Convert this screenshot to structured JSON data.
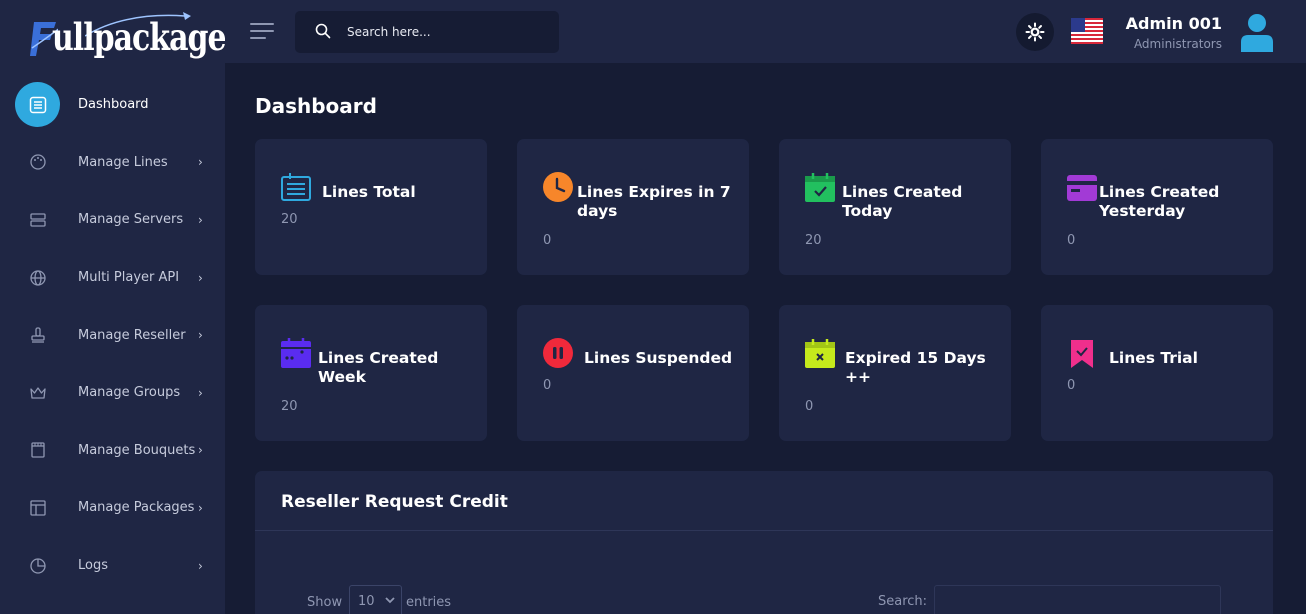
{
  "brand": {
    "logo_text": "ullpackage"
  },
  "sidebar": {
    "items": [
      {
        "label": "Dashboard",
        "icon": "dashboard-icon",
        "active": true
      },
      {
        "label": "Manage Lines",
        "icon": "palette-icon"
      },
      {
        "label": "Manage Servers",
        "icon": "server-icon"
      },
      {
        "label": "Multi Player API",
        "icon": "globe-icon"
      },
      {
        "label": "Manage Reseller",
        "icon": "stamp-icon"
      },
      {
        "label": "Manage Groups",
        "icon": "crown-icon"
      },
      {
        "label": "Manage Bouquets",
        "icon": "film-icon"
      },
      {
        "label": "Manage Packages",
        "icon": "layout-icon"
      },
      {
        "label": "Logs",
        "icon": "pie-chart-icon"
      }
    ],
    "chevron": "›"
  },
  "topbar": {
    "search_placeholder": "Search here...",
    "user_name": "Admin 001",
    "user_role": "Administrators"
  },
  "page": {
    "title": "Dashboard"
  },
  "cards": [
    {
      "title": "Lines Total",
      "value": "20",
      "icon": "list-icon",
      "color": "#2fa9df"
    },
    {
      "title": "Lines Expires in 7 days",
      "value": "0",
      "icon": "clock-icon",
      "color": "#f7862a"
    },
    {
      "title": "Lines Created Today",
      "value": "20",
      "icon": "calendar-check-icon",
      "color": "#22c05f"
    },
    {
      "title": "Lines Created Yesterday",
      "value": "0",
      "icon": "card-icon",
      "color": "#a23ad6"
    },
    {
      "title": "Lines Created Week",
      "value": "20",
      "icon": "calendar-week-icon",
      "color": "#5a2cf0"
    },
    {
      "title": "Lines Suspended",
      "value": "0",
      "icon": "pause-icon",
      "color": "#f0293b"
    },
    {
      "title": "Expired 15 Days ++",
      "value": "0",
      "icon": "calendar-x-icon",
      "color": "#c5ea1c"
    },
    {
      "title": "Lines Trial",
      "value": "0",
      "icon": "bookmark-check-icon",
      "color": "#f02f8c"
    }
  ],
  "reseller_panel": {
    "title": "Reseller Request Credit",
    "show_label": "Show",
    "entries_value": "10",
    "entries_label": "entries",
    "search_label": "Search:"
  }
}
